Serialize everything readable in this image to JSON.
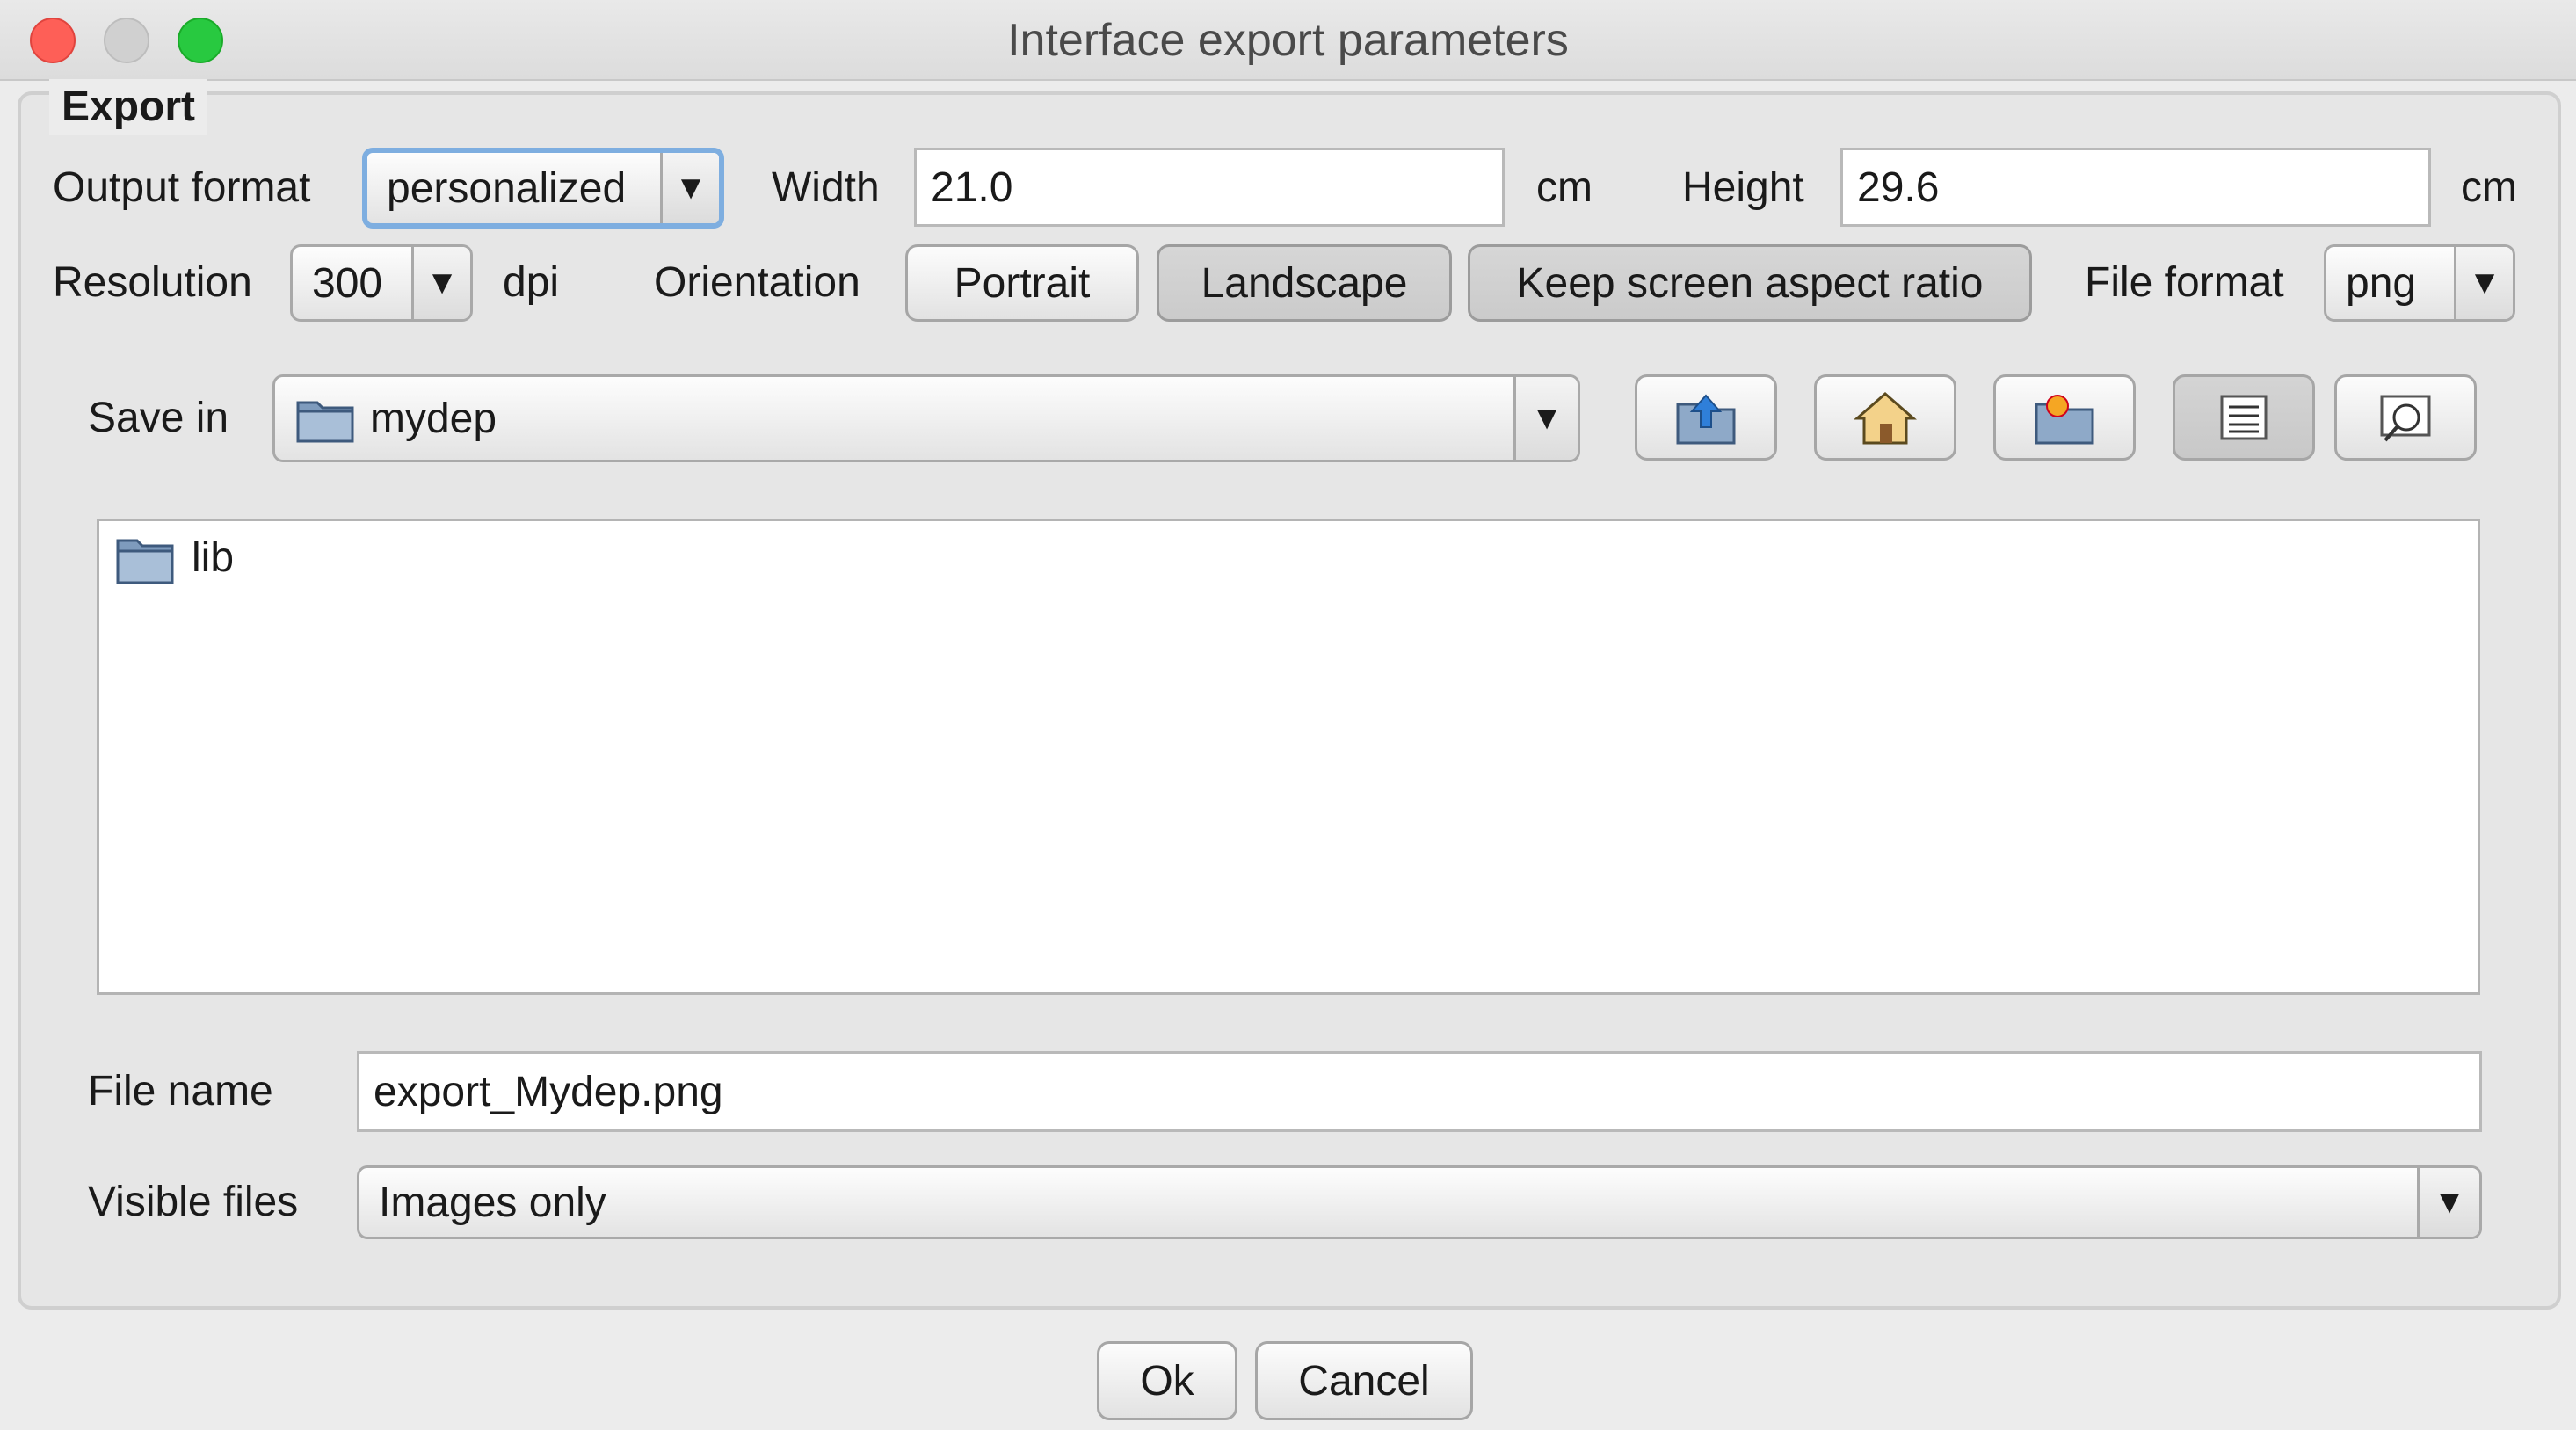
{
  "window": {
    "title": "Interface export parameters",
    "traffic_colors": {
      "close": "#fe5f57",
      "minimize": "#d0d0d0",
      "zoom": "#28c940"
    }
  },
  "group": {
    "title": "Export"
  },
  "output_format": {
    "label": "Output format",
    "value": "personalized"
  },
  "width": {
    "label": "Width",
    "value": "21.0",
    "unit": "cm"
  },
  "height": {
    "label": "Height",
    "value": "29.6",
    "unit": "cm"
  },
  "resolution": {
    "label": "Resolution",
    "value": "300",
    "unit": "dpi"
  },
  "orientation": {
    "label": "Orientation",
    "portrait": "Portrait",
    "landscape": "Landscape",
    "keep_ratio": "Keep screen aspect ratio",
    "selected": "Landscape"
  },
  "file_format": {
    "label": "File format",
    "value": "png"
  },
  "save_in": {
    "label": "Save in",
    "value": "mydep"
  },
  "toolbar_icons": [
    "up-folder-icon",
    "home-icon",
    "new-folder-icon",
    "list-view-icon",
    "details-view-icon"
  ],
  "files": [
    {
      "name": "lib",
      "icon": "folder-icon"
    }
  ],
  "file_name": {
    "label": "File name",
    "value": "export_Mydep.png"
  },
  "visible_files": {
    "label": "Visible files",
    "value": "Images only"
  },
  "buttons": {
    "ok": "Ok",
    "cancel": "Cancel"
  }
}
